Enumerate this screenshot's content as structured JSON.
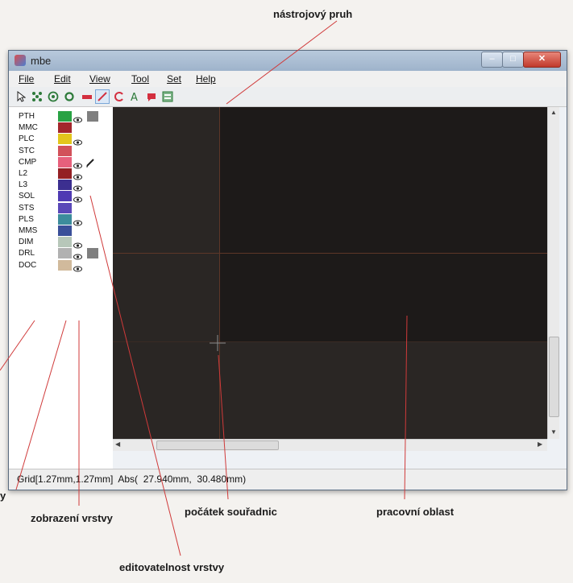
{
  "annotations": {
    "toolbar": "nástrojový pruh",
    "layer_visibility": "zobrazení vrstvy",
    "origin": "počátek souřadnic",
    "workspace": "pracovní oblast",
    "layer_editability": "editovatelnost vrstvy",
    "partial_left": "y"
  },
  "window": {
    "title": "mbe",
    "menu": [
      "File",
      "Edit",
      "View",
      "Tool",
      "Set",
      "Help"
    ]
  },
  "toolbar": {
    "tools": [
      "select-icon",
      "move-icon",
      "via-icon",
      "pad-icon",
      "rect-pad-icon",
      "line-icon",
      "arc-icon",
      "text-icon",
      "fill-icon",
      "component-icon"
    ],
    "active_tool": "line-icon"
  },
  "layers": [
    {
      "name": "PTH",
      "color": "#29a244",
      "visible": true,
      "selected": true
    },
    {
      "name": "MMC",
      "color": "#a3272c",
      "visible": false
    },
    {
      "name": "PLC",
      "color": "#e3c61c",
      "visible": true
    },
    {
      "name": "STC",
      "color": "#d2515a",
      "visible": false
    },
    {
      "name": "CMP",
      "color": "#e7607c",
      "visible": true,
      "editable": true
    },
    {
      "name": "L2",
      "color": "#942024",
      "visible": true
    },
    {
      "name": "L3",
      "color": "#3c2f90",
      "visible": true
    },
    {
      "name": "SOL",
      "color": "#4f3ab3",
      "visible": true
    },
    {
      "name": "STS",
      "color": "#5a48b8",
      "visible": false
    },
    {
      "name": "PLS",
      "color": "#3c8c9c",
      "visible": true
    },
    {
      "name": "MMS",
      "color": "#3a4f99",
      "visible": false
    },
    {
      "name": "DIM",
      "color": "#b7c7b9",
      "visible": true
    },
    {
      "name": "DRL",
      "color": "#b1b1b1",
      "visible": true,
      "selected": true
    },
    {
      "name": "DOC",
      "color": "#d1ba9c",
      "visible": true
    }
  ],
  "status": {
    "text": "Grid[1.27mm,1.27mm]  Abs(  27.940mm,  30.480mm)"
  },
  "colors": {
    "canvas": "#2a2624",
    "board": "#1d1a19",
    "grid_line": "#5d3728"
  }
}
